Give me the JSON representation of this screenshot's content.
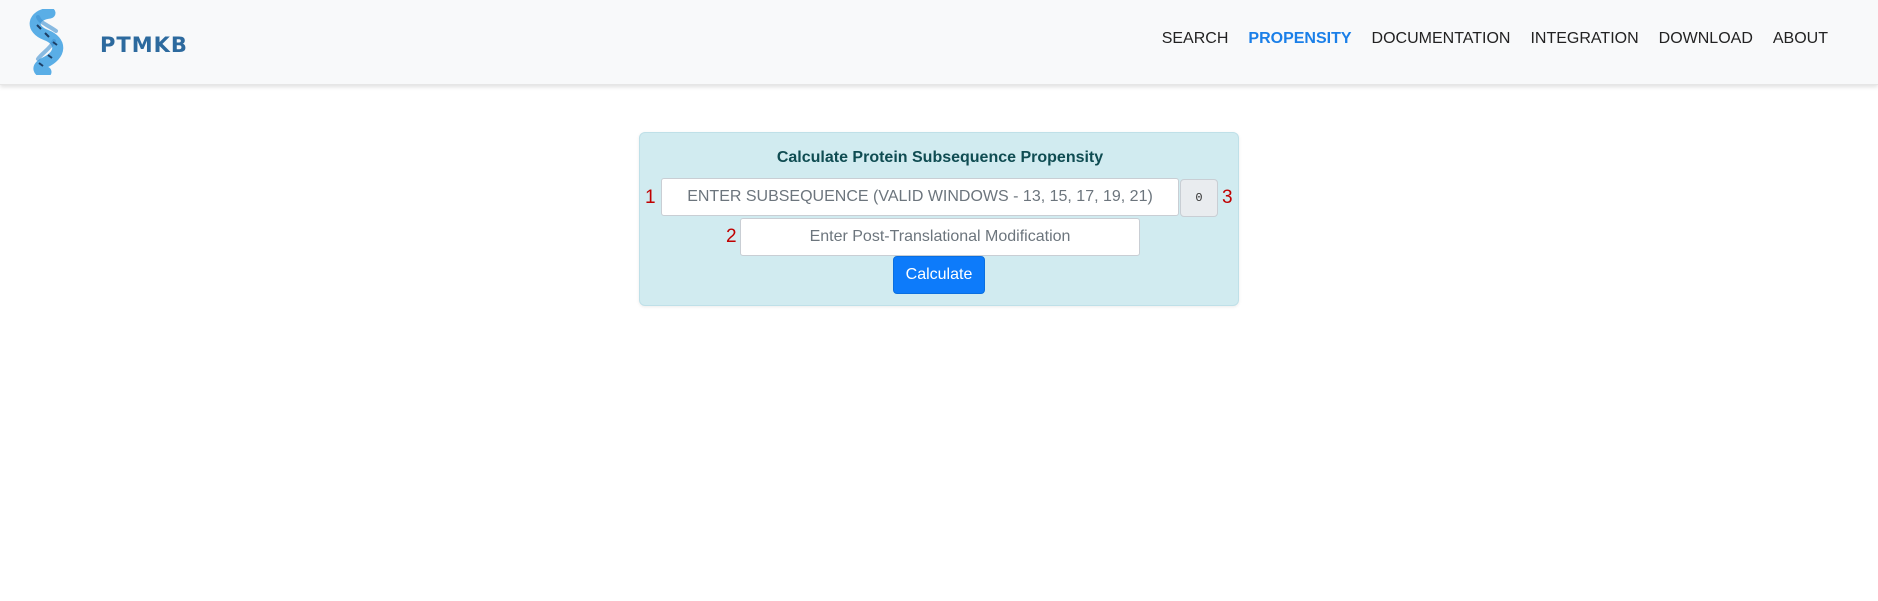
{
  "header": {
    "logo_text": "PTMKB",
    "nav": [
      {
        "label": "SEARCH",
        "active": false
      },
      {
        "label": "PROPENSITY",
        "active": true
      },
      {
        "label": "DOCUMENTATION",
        "active": false
      },
      {
        "label": "INTEGRATION",
        "active": false
      },
      {
        "label": "DOWNLOAD",
        "active": false
      },
      {
        "label": "ABOUT",
        "active": false
      }
    ],
    "active_color": "#1a7fe8",
    "logo_color": "#2d6a9e"
  },
  "form": {
    "title": "Calculate Protein Subsequence Propensity",
    "subsequence_placeholder": "ENTER SUBSEQUENCE (VALID WINDOWS - 13, 15, 17, 19, 21)",
    "subsequence_value": "",
    "ptm_placeholder": "Enter Post-Translational Modification",
    "ptm_value": "",
    "char_count": "0",
    "calculate_label": "Calculate",
    "labels": {
      "one": "1",
      "two": "2",
      "three": "3"
    },
    "card_color": "#d1ebf0",
    "button_color": "#0d7bfa"
  }
}
